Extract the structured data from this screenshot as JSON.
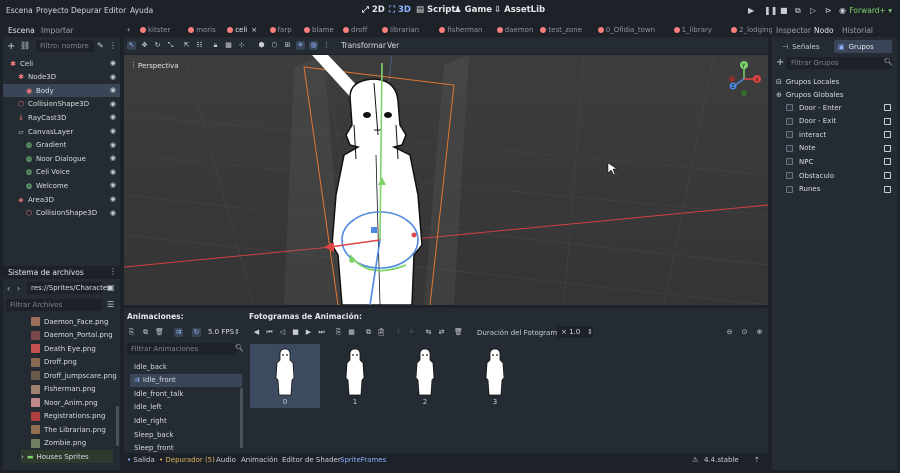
{
  "menubar": {
    "menus": [
      "Escena",
      "Proyecto",
      "Depurar",
      "Editor",
      "Ayuda"
    ],
    "workspaces": [
      {
        "label": "2D",
        "active": false
      },
      {
        "label": "3D",
        "active": true
      },
      {
        "label": "Script",
        "active": false
      },
      {
        "label": "Game",
        "active": false
      },
      {
        "label": "AssetLib",
        "active": false
      }
    ],
    "renderer": "Forward+"
  },
  "scene_dock": {
    "tabs": [
      "Escena",
      "Importar"
    ],
    "filter_placeholder": "Filtro: nombre",
    "tree": [
      {
        "label": "Celi",
        "icon": "node3d-icon",
        "indent": 0,
        "color": "#fc7f7f"
      },
      {
        "label": "Node3D",
        "icon": "node3d-icon",
        "indent": 1,
        "color": "#fc7f7f"
      },
      {
        "label": "Body",
        "icon": "sprite3d-icon",
        "indent": 2,
        "color": "#fc7f7f",
        "selected": true
      },
      {
        "label": "CollisionShape3D",
        "icon": "collision-icon",
        "indent": 1,
        "color": "#fc7f7f"
      },
      {
        "label": "RayCast3D",
        "icon": "raycast-icon",
        "indent": 1,
        "color": "#fc7f7f"
      },
      {
        "label": "CanvasLayer",
        "icon": "canvas-layer-icon",
        "indent": 1,
        "color": "#c9cdd3"
      },
      {
        "label": "Gradient",
        "icon": "control-icon",
        "indent": 2,
        "color": "#8eef97"
      },
      {
        "label": "Noor Dialogue",
        "icon": "control-icon",
        "indent": 2,
        "color": "#8eef97"
      },
      {
        "label": "Celi Voice",
        "icon": "control-icon",
        "indent": 2,
        "color": "#8eef97"
      },
      {
        "label": "Welcome",
        "icon": "control-icon",
        "indent": 2,
        "color": "#8eef97"
      },
      {
        "label": "Area3D",
        "icon": "area3d-icon",
        "indent": 1,
        "color": "#fc7f7f"
      },
      {
        "label": "CollisionShape3D",
        "icon": "collision-icon",
        "indent": 2,
        "color": "#fc7f7f"
      }
    ]
  },
  "fs_dock": {
    "title": "Sistema de archivos",
    "path": "res://Sprites/Character",
    "filter_placeholder": "Filtrar Archivos",
    "files": [
      {
        "label": "Daemon_Face.png",
        "color": "#9b6f5a"
      },
      {
        "label": "Daemon_Portal.png",
        "color": "#7a4a4a"
      },
      {
        "label": "Death Eye.png",
        "color": "#c25050"
      },
      {
        "label": "Droff.png",
        "color": "#8a6a50"
      },
      {
        "label": "Droff_jumpscare.png",
        "color": "#6b5b4b"
      },
      {
        "label": "Fisherman.png",
        "color": "#a08070"
      },
      {
        "label": "Noor_Anim.png",
        "color": "#c08a8a"
      },
      {
        "label": "Registrations.png",
        "color": "#b04040"
      },
      {
        "label": "The Librarian.png",
        "color": "#907050"
      },
      {
        "label": "Zombie.png",
        "color": "#708060"
      }
    ],
    "folder": "Houses Sprites"
  },
  "editor_tabs": [
    {
      "label": "kitster",
      "color": "#fc7f7f"
    },
    {
      "label": "moris",
      "color": "#fc7f7f"
    },
    {
      "label": "celi",
      "color": "#fc7f7f",
      "active": true
    },
    {
      "label": "farp",
      "color": "#fc7f7f"
    },
    {
      "label": "blame",
      "color": "#fc7f7f"
    },
    {
      "label": "droff",
      "color": "#fc7f7f"
    },
    {
      "label": "librarian",
      "color": "#fc7f7f"
    },
    {
      "label": "fisherman",
      "color": "#fc7f7f"
    },
    {
      "label": "daemon",
      "color": "#fc7f7f"
    },
    {
      "label": "test_zone",
      "color": "#fc7f7f"
    },
    {
      "label": "0_Ofidia_town",
      "color": "#fc7f7f"
    },
    {
      "label": "1_library",
      "color": "#fc7f7f"
    },
    {
      "label": "2_lodging",
      "color": "#fc7f7f"
    }
  ],
  "toolbar": {
    "transform_label": "Transformar",
    "view_label": "Ver"
  },
  "viewport": {
    "perspective_label": "Perspectiva",
    "gizmo_axes": [
      "Y",
      "X",
      "Z"
    ]
  },
  "anim_panel": {
    "animations_title": "Animaciones:",
    "fps": "5.0 FPS",
    "filter_placeholder": "Filtrar Animaciones",
    "animations": [
      {
        "label": "Idle_back"
      },
      {
        "label": "Idle_front",
        "selected": true
      },
      {
        "label": "Idle_front_talk"
      },
      {
        "label": "Idle_left"
      },
      {
        "label": "Idle_right"
      },
      {
        "label": "Sleep_back"
      },
      {
        "label": "Sleep_front"
      }
    ],
    "frames_title": "Fotogramas de Animación:",
    "frame_duration_label": "Duración del Fotograma:",
    "frame_duration_value": "× 1.0",
    "frames": [
      "0",
      "1",
      "2",
      "3"
    ]
  },
  "statusbar": {
    "items": [
      "Salida",
      "Depurador (5)",
      "Audio",
      "Animación",
      "Editor de Shader",
      "SpriteFrames"
    ],
    "version": "4.4.stable"
  },
  "right_dock": {
    "tabs": [
      "Inspector",
      "Nodo",
      "Historial"
    ],
    "subtabs": [
      "Señales",
      "Grupos"
    ],
    "filter_placeholder": "Filtrar Grupos",
    "local_groups": "Grupos Locales",
    "global_groups": "Grupos Globales",
    "groups": [
      "Door - Enter",
      "Door - Exit",
      "interact",
      "Note",
      "NPC",
      "Obstaculo",
      "Runes"
    ]
  }
}
